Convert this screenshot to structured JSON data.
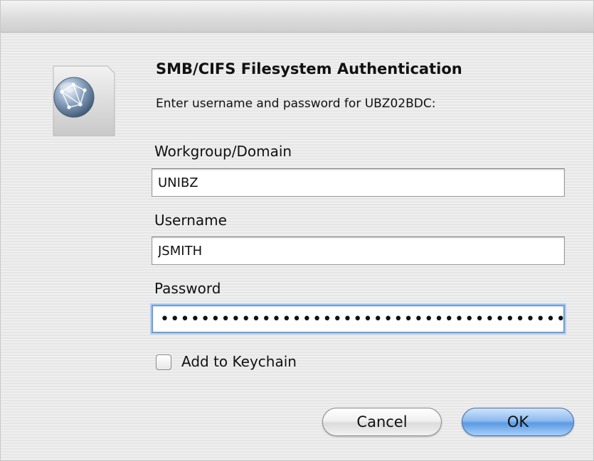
{
  "dialog": {
    "title": "SMB/CIFS Filesystem Authentication",
    "message": "Enter username and password for UBZ02BDC:",
    "icon": "network-globe-icon"
  },
  "fields": {
    "workgroup": {
      "label": "Workgroup/Domain",
      "value": "UNIBZ"
    },
    "username": {
      "label": "Username",
      "value": "JSMITH"
    },
    "password": {
      "label": "Password",
      "masked_value": "••••••••••••••••••••••••••••••••••••••••"
    }
  },
  "keychain": {
    "label": "Add to Keychain",
    "checked": false
  },
  "buttons": {
    "cancel": "Cancel",
    "ok": "OK"
  },
  "colors": {
    "default_button": "#5b9ae3",
    "focus_ring": "#6d9fd8"
  }
}
